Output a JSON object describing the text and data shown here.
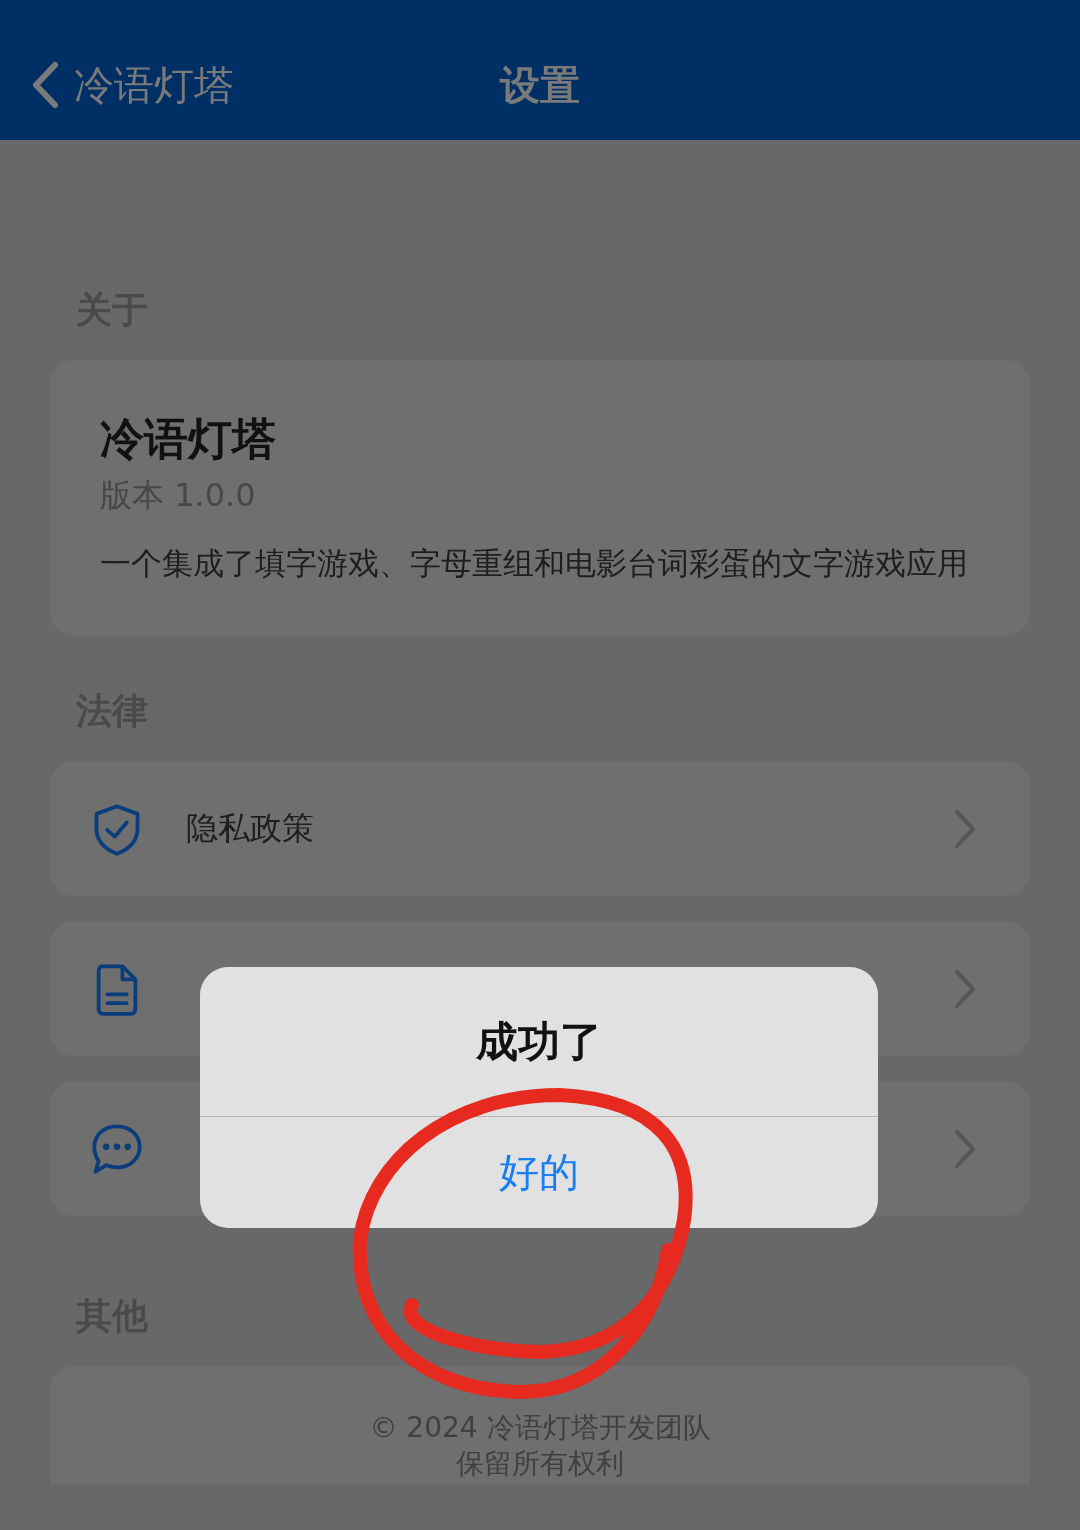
{
  "nav": {
    "back_label": "冷语灯塔",
    "title": "设置"
  },
  "sections": [
    {
      "header": "关于",
      "kind": "about",
      "app_name": "冷语灯塔",
      "version": "版本 1.0.0",
      "description": "一个集成了填字游戏、字母重组和电影台词彩蛋的文字游戏应用"
    },
    {
      "header": "法律",
      "kind": "links",
      "items": [
        {
          "kind": "shield",
          "label": "隐私政策"
        },
        {
          "kind": "document"
        },
        {
          "kind": "chat"
        }
      ]
    },
    {
      "header": "其他",
      "kind": "footer",
      "lines": [
        "© 2024 冷语灯塔开发团队",
        "保留所有权利"
      ]
    }
  ],
  "dialog": {
    "title": "成功了",
    "button": "好的"
  },
  "annotation": {
    "kind": "circle"
  }
}
